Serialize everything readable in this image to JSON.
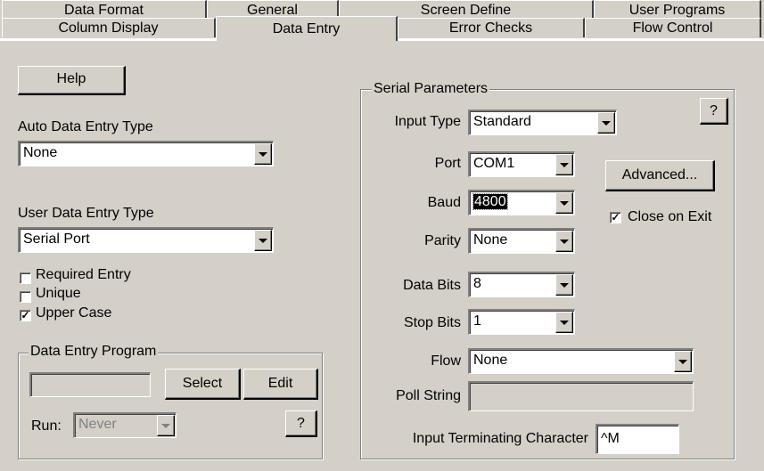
{
  "tabs_back": [
    {
      "label": "Data Format"
    },
    {
      "label": "General"
    },
    {
      "label": "Screen Define"
    },
    {
      "label": "User Programs"
    }
  ],
  "tabs_front": [
    {
      "label": "Column Display"
    },
    {
      "label": "Data Entry"
    },
    {
      "label": "Error Checks"
    },
    {
      "label": "Flow Control"
    }
  ],
  "left": {
    "help_label": "Help",
    "auto_label": "Auto Data Entry Type",
    "auto_value": "None",
    "user_label": "User Data Entry Type",
    "user_value": "Serial Port",
    "checks": [
      {
        "label": "Required Entry",
        "checked": false
      },
      {
        "label": "Unique",
        "checked": false
      },
      {
        "label": "Upper Case",
        "checked": true
      }
    ],
    "program": {
      "title": "Data Entry Program",
      "select_label": "Select",
      "edit_label": "Edit",
      "run_label": "Run:",
      "run_value": "Never",
      "help_q": "?"
    }
  },
  "serial": {
    "title": "Serial Parameters",
    "help_q": "?",
    "input_type_label": "Input Type",
    "input_type_value": "Standard",
    "port_label": "Port",
    "port_value": "COM1",
    "advanced_label": "Advanced...",
    "baud_label": "Baud",
    "baud_value": "4800",
    "close_on_exit_label": "Close on Exit",
    "close_on_exit_checked": true,
    "parity_label": "Parity",
    "parity_value": "None",
    "data_bits_label": "Data Bits",
    "data_bits_value": "8",
    "stop_bits_label": "Stop Bits",
    "stop_bits_value": "1",
    "flow_label": "Flow",
    "flow_value": "None",
    "poll_label": "Poll String",
    "poll_value": "",
    "term_label": "Input Terminating Character",
    "term_value": "^M"
  }
}
